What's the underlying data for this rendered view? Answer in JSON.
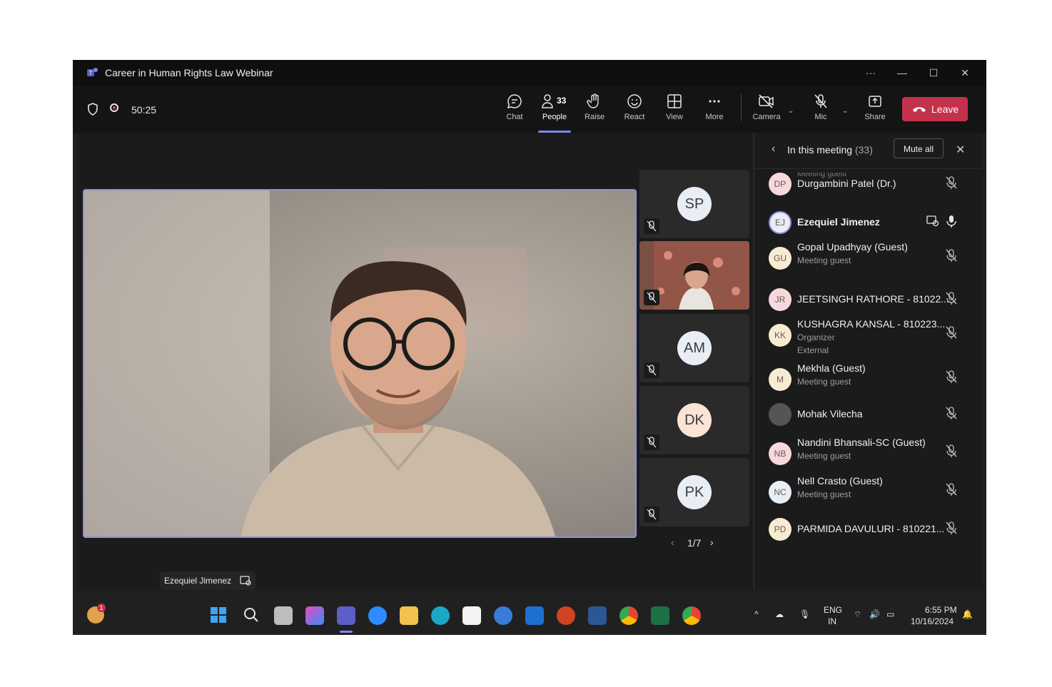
{
  "window": {
    "title": "Career in Human Rights Law Webinar"
  },
  "toolbar": {
    "timer": "50:25",
    "buttons": [
      {
        "label": "Chat",
        "icon": "chat-icon"
      },
      {
        "label": "People",
        "icon": "people-icon",
        "badge": "33"
      },
      {
        "label": "Raise",
        "icon": "hand-icon"
      },
      {
        "label": "React",
        "icon": "smile-icon"
      },
      {
        "label": "View",
        "icon": "grid-icon"
      },
      {
        "label": "More",
        "icon": "more-icon"
      },
      {
        "label": "Camera",
        "icon": "camera-off-icon"
      },
      {
        "label": "Mic",
        "icon": "mic-off-icon"
      },
      {
        "label": "Share",
        "icon": "share-icon"
      }
    ],
    "leave_label": "Leave",
    "leave_color": "#c4314b"
  },
  "stage": {
    "speaker_name": "Ezequiel Jimenez",
    "thumbnails": [
      "SP",
      "",
      "AM",
      "DK",
      "PK"
    ],
    "pager": "1/7"
  },
  "panel": {
    "title": "In this meeting",
    "count": "(33)",
    "mute_all": "Mute all",
    "partial_top": "Meeting guest",
    "participants": [
      {
        "initials": "DP",
        "name": "Durgambini Patel (Dr.)",
        "sub": [],
        "mic": "off"
      },
      {
        "initials": "EJ",
        "name": "Ezequiel Jimenez",
        "sub": [],
        "mic": "on"
      },
      {
        "initials": "GU",
        "name": "Gopal Upadhyay (Guest)",
        "sub": [
          "Meeting guest"
        ],
        "mic": "off"
      },
      {
        "initials": "JR",
        "name": "JEETSINGH RATHORE - 81022...",
        "sub": [],
        "mic": "off"
      },
      {
        "initials": "KK",
        "name": "KUSHAGRA KANSAL - 810223...",
        "sub": [
          "Organizer",
          "External"
        ],
        "mic": "off"
      },
      {
        "initials": "M",
        "name": "Mekhla (Guest)",
        "sub": [
          "Meeting guest"
        ],
        "mic": "off"
      },
      {
        "initials": "",
        "name": "Mohak Vilecha",
        "sub": [],
        "mic": "off"
      },
      {
        "initials": "NB",
        "name": "Nandini Bhansali-SC (Guest)",
        "sub": [
          "Meeting guest"
        ],
        "mic": "off"
      },
      {
        "initials": "NC",
        "name": "Nell Crasto (Guest)",
        "sub": [
          "Meeting guest"
        ],
        "mic": "off"
      },
      {
        "initials": "PD",
        "name": "PARMIDA DAVULURI - 810221...",
        "sub": [],
        "mic": "off"
      }
    ]
  },
  "taskbar": {
    "notif_badge": "1",
    "lang": "ENG",
    "region": "IN",
    "time": "6:55 PM",
    "date": "10/16/2024"
  },
  "colors": {
    "accent": "#7f85f5",
    "leave": "#c4314b",
    "bg": "#1f1f1f"
  }
}
